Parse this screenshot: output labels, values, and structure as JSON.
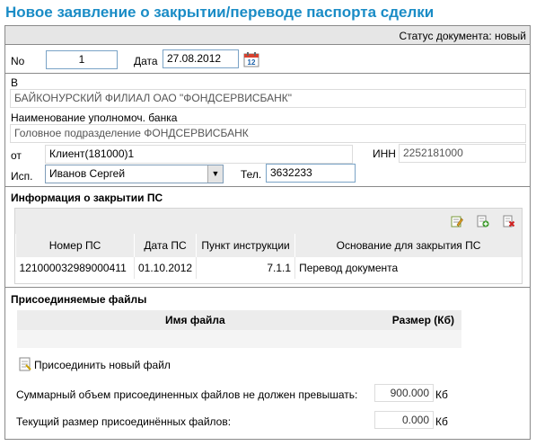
{
  "page": {
    "title": "Новое заявление о закрытии/переводе паспорта сделки"
  },
  "status": {
    "text": "Статус документа: новый"
  },
  "header": {
    "no_label": "No",
    "no_value": "1",
    "date_label": "Дата",
    "date_value": "27.08.2012"
  },
  "bank": {
    "to_label": "В",
    "to_value": "БАЙКОНУРСКИЙ ФИЛИАЛ ОАО \"ФОНДСЕРВИСБАНК\"",
    "authorized_label": "Наименование уполномоч. банка",
    "authorized_value": "Головное подразделение ФОНДСЕРВИСБАНК"
  },
  "client": {
    "from_label": "от",
    "from_value": "Клиент(181000)1",
    "inn_label": "ИНН",
    "inn_value": "2252181000",
    "executor_label": "Исп.",
    "executor_value": "Иванов Сергей",
    "phone_label": "Тел.",
    "phone_value": "3632233"
  },
  "closure": {
    "section_title": "Информация о закрытии ПС",
    "columns": [
      "Номер ПС",
      "Дата ПС",
      "Пункт инструкции",
      "Основание для закрытия ПС"
    ],
    "rows": [
      {
        "number": "121000032989000411",
        "date": "01.10.2012",
        "clause": "7.1.1",
        "reason": "Перевод документа"
      }
    ],
    "icons": [
      "edit-icon",
      "add-icon",
      "delete-icon"
    ]
  },
  "files": {
    "section_title": "Присоединяемые файлы",
    "col_name": "Имя файла",
    "col_size": "Размер (Кб)",
    "attach_label": "Присоединить новый файл",
    "max_label": "Суммарный объем присоединенных файлов не должен превышать:",
    "max_value": "900.000",
    "current_label": "Текущий размер присоединённых файлов:",
    "current_value": "0.000",
    "unit": "Кб"
  },
  "colors": {
    "title": "#1a8cc6",
    "input_border": "#7aa3c6",
    "header_bg": "#ececec"
  }
}
